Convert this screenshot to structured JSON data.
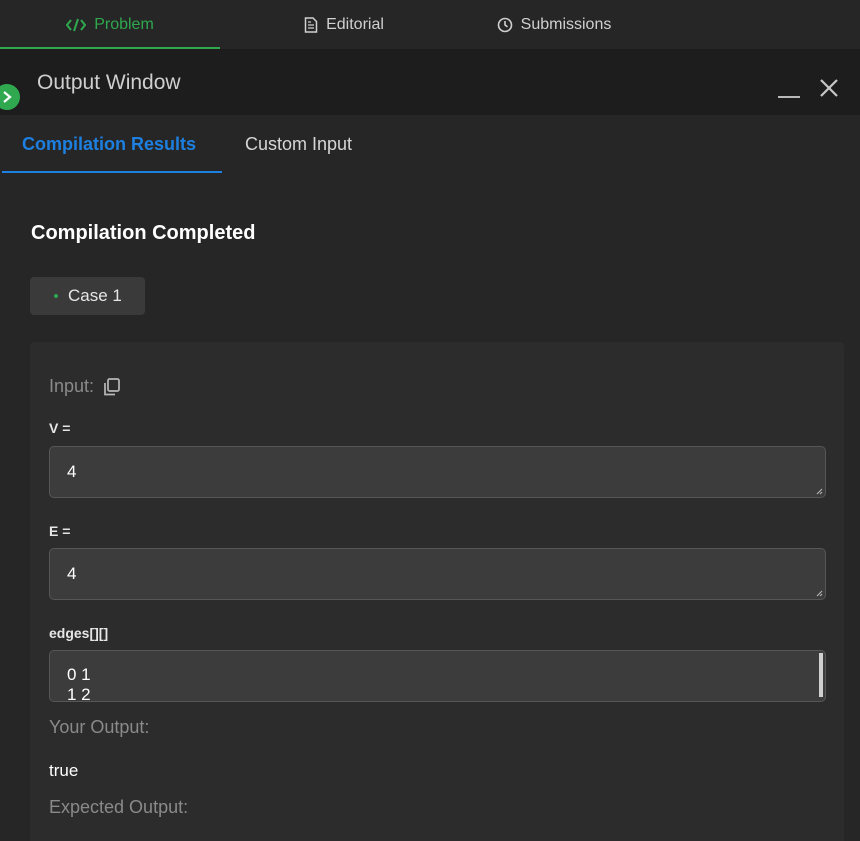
{
  "nav": {
    "tabs": [
      {
        "label": "Problem",
        "icon": "code-icon",
        "active": true
      },
      {
        "label": "Editorial",
        "icon": "document-icon",
        "active": false
      },
      {
        "label": "Submissions",
        "icon": "clock-icon",
        "active": false
      }
    ]
  },
  "output_window": {
    "title": "Output Window",
    "tabs": [
      {
        "label": "Compilation Results",
        "active": true
      },
      {
        "label": "Custom Input",
        "active": false
      }
    ],
    "status": "Compilation Completed",
    "case": {
      "label": "Case 1"
    },
    "input_label": "Input:",
    "params": [
      {
        "label": "V =",
        "value": "4"
      },
      {
        "label": "E =",
        "value": "4"
      },
      {
        "label": "edges[][]",
        "lines": [
          "0 1",
          "1 2"
        ]
      }
    ],
    "your_output_label": "Your Output:",
    "your_output_value": "true",
    "expected_output_label": "Expected Output:"
  },
  "colors": {
    "accent_green": "#2fa84f",
    "accent_blue": "#1d7fe0",
    "background": "#262626",
    "panel": "#2c2c2c"
  }
}
